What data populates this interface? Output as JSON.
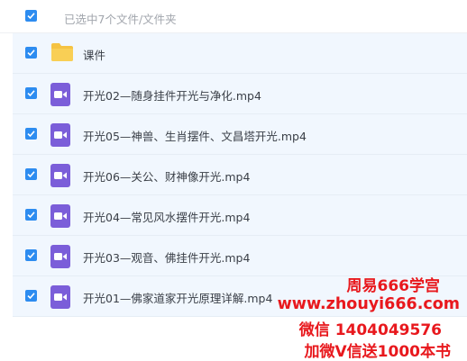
{
  "header": {
    "selection_text": "已选中7个文件/文件夹"
  },
  "items": [
    {
      "name": "课件",
      "type": "folder"
    },
    {
      "name": "开光02—随身挂件开光与净化.mp4",
      "type": "video"
    },
    {
      "name": "开光05—神兽、生肖摆件、文昌塔开光.mp4",
      "type": "video"
    },
    {
      "name": "开光06—关公、财神像开光.mp4",
      "type": "video"
    },
    {
      "name": "开光04—常见风水摆件开光.mp4",
      "type": "video"
    },
    {
      "name": "开光03—观音、佛挂件开光.mp4",
      "type": "video"
    },
    {
      "name": "开光01—佛家道家开光原理详解.mp4",
      "type": "video"
    }
  ],
  "watermark": {
    "line1": "周易666学宫",
    "line2": "www.zhouyi666.com",
    "line3": "微信 1404049576",
    "line4": "加微V信送1000本书"
  },
  "colors": {
    "checkbox": "#2d8cf0",
    "folder": "#f5c342",
    "video": "#7b5ed9",
    "watermark": "#e8181d"
  }
}
